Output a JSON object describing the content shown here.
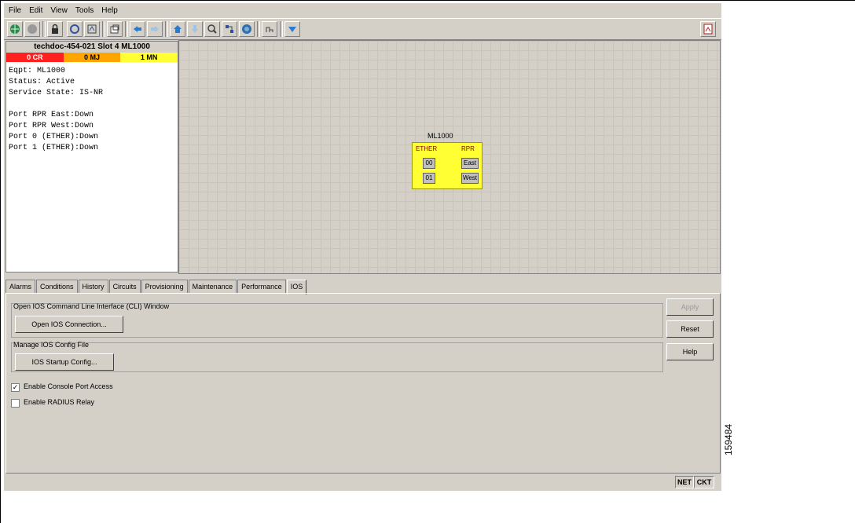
{
  "menu": [
    "File",
    "Edit",
    "View",
    "Tools",
    "Help"
  ],
  "toolbar": {
    "icons": [
      "globe-icon",
      "stop-icon",
      "lock-icon",
      "refresh-icon",
      "network-icon",
      "window-icon",
      "back-icon",
      "forward-icon",
      "home-icon",
      "down-icon",
      "zoom-icon",
      "circuits-icon",
      "node-icon",
      "ring-icon",
      "nav-icon",
      "pdf-icon"
    ]
  },
  "node": {
    "title": "techdoc-454-021 Slot 4 ML1000",
    "alarms": [
      {
        "label": "0 CR",
        "color": "#ff2020"
      },
      {
        "label": "0 MJ",
        "color": "#ffa500"
      },
      {
        "label": "1 MN",
        "color": "#ffff33"
      }
    ],
    "lines": [
      "Eqpt: ML1000",
      "Status: Active",
      "Service State: IS-NR",
      "",
      "Port RPR East:Down",
      "Port RPR West:Down",
      "Port 0 (ETHER):Down",
      "Port 1 (ETHER):Down"
    ]
  },
  "card": {
    "name": "ML1000",
    "ether_label": "ETHER",
    "rpr_label": "RPR",
    "ports": [
      "00",
      "01",
      "East",
      "West"
    ]
  },
  "tabs": [
    "Alarms",
    "Conditions",
    "History",
    "Circuits",
    "Provisioning",
    "Maintenance",
    "Performance",
    "IOS"
  ],
  "ios": {
    "cli_group_title": "Open IOS Command Line Interface (CLI) Window",
    "open_connection": "Open IOS Connection...",
    "config_group_title": "Manage IOS Config File",
    "startup_config": "IOS Startup Config...",
    "console_access": "Enable Console Port Access",
    "console_access_checked": true,
    "radius_relay": "Enable RADIUS Relay",
    "radius_relay_checked": false
  },
  "side_buttons": {
    "apply": "Apply",
    "reset": "Reset",
    "help": "Help"
  },
  "status": {
    "net": "NET",
    "ckt": "CKT"
  },
  "figure_number": "159484"
}
